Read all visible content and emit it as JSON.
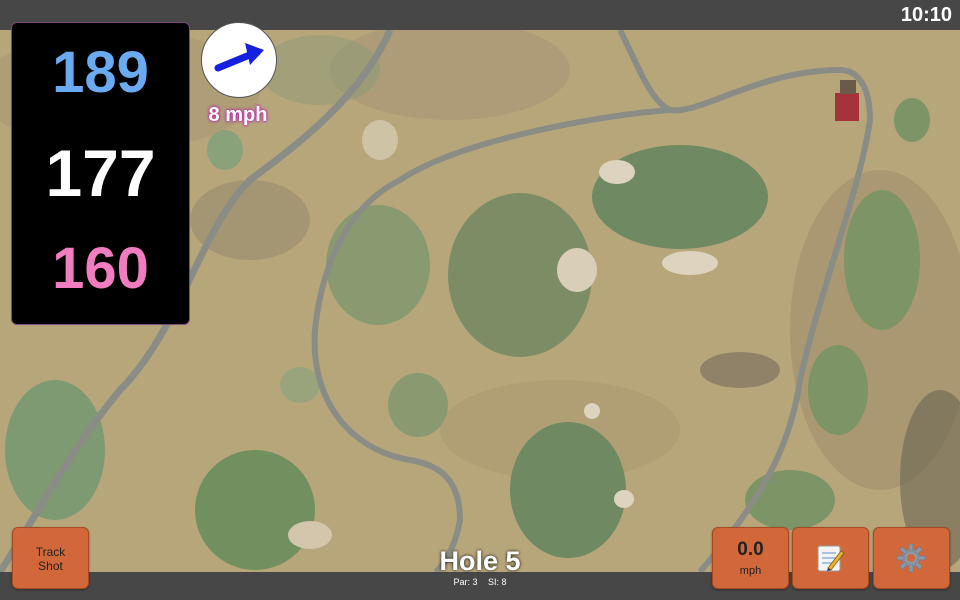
{
  "status_bar": {
    "time": "10:10"
  },
  "yardages": {
    "back": "189",
    "middle": "177",
    "front": "160"
  },
  "wind": {
    "speed": "8 mph",
    "direction_icon": "arrow-right-up-icon"
  },
  "hole": {
    "title": "Hole 5",
    "par": "Par: 3",
    "si": "SI: 8"
  },
  "buttons": {
    "track_line1": "Track",
    "track_line2": "Shot",
    "speed_value": "0.0",
    "speed_unit": "mph",
    "notes_icon": "notepad-icon",
    "settings_icon": "gear-icon"
  },
  "colors": {
    "back": "#6aaaf0",
    "middle": "#ffffff",
    "front": "#f07dbf",
    "button": "#d2683a",
    "wind_arrow": "#1420e0",
    "wind_glow": "#c035a8"
  }
}
